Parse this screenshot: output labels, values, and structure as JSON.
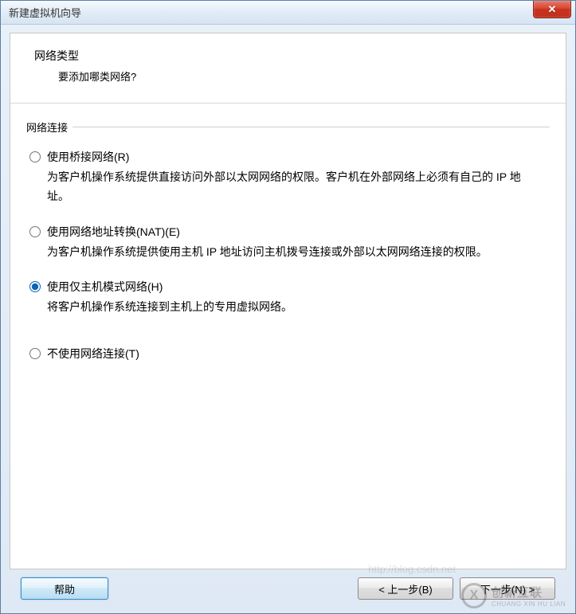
{
  "window": {
    "title": "新建虚拟机向导"
  },
  "header": {
    "title": "网络类型",
    "subtitle": "要添加哪类网络?"
  },
  "fieldset": {
    "legend": "网络连接"
  },
  "options": {
    "bridged": {
      "label": "使用桥接网络(R)",
      "desc": "为客户机操作系统提供直接访问外部以太网网络的权限。客户机在外部网络上必须有自己的 IP 地址。"
    },
    "nat": {
      "label": "使用网络地址转换(NAT)(E)",
      "desc": "为客户机操作系统提供使用主机 IP 地址访问主机拨号连接或外部以太网网络连接的权限。"
    },
    "hostonly": {
      "label": "使用仅主机模式网络(H)",
      "desc": "将客户机操作系统连接到主机上的专用虚拟网络。"
    },
    "none": {
      "label": "不使用网络连接(T)"
    },
    "selected": "hostonly"
  },
  "buttons": {
    "help": "帮助",
    "back": "< 上一步(B)",
    "next": "下一步(N) >"
  },
  "watermark": {
    "brand": "创新互联",
    "sub": "CHUANG XIN HU LIAN",
    "url": "http://blog.csdn.net"
  }
}
